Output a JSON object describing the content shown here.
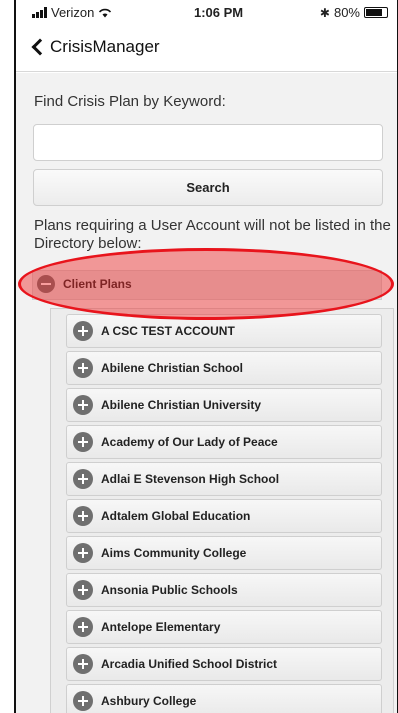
{
  "status_bar": {
    "carrier": "Verizon",
    "time": "1:06 PM",
    "battery_percent": "80%",
    "battery_level": 0.8
  },
  "nav": {
    "back_label": "CrisisManager"
  },
  "search": {
    "label": "Find Crisis Plan by Keyword:",
    "value": "",
    "placeholder": "",
    "button_label": "Search"
  },
  "info_text": "Plans requiring a User Account will not be listed in the Directory below:",
  "client_plans": {
    "title": "Client Plans",
    "expanded": true,
    "items": [
      "A CSC TEST ACCOUNT",
      "Abilene Christian School",
      "Abilene Christian University",
      "Academy of Our Lady of Peace",
      "Adlai E Stevenson High School",
      "Adtalem Global Education",
      "Aims Community College",
      "Ansonia Public Schools",
      "Antelope Elementary",
      "Arcadia Unified School District",
      "Ashbury College"
    ]
  },
  "colors": {
    "highlight": "#e8141c",
    "content_bg": "#f2f2f2"
  }
}
